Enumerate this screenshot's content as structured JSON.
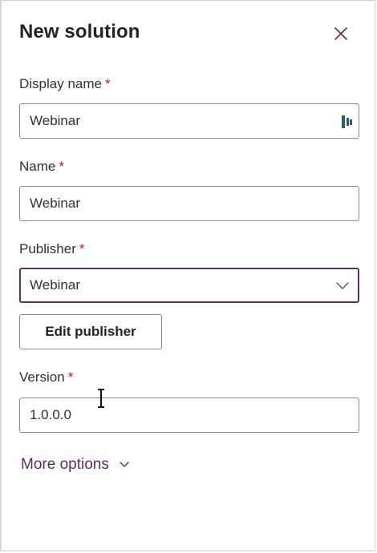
{
  "panel": {
    "title": "New solution",
    "close_icon": "close-icon"
  },
  "fields": {
    "display_name": {
      "label": "Display name",
      "required": "*",
      "value": "Webinar"
    },
    "name": {
      "label": "Name",
      "required": "*",
      "value": "Webinar"
    },
    "publisher": {
      "label": "Publisher",
      "required": "*",
      "value": "Webinar"
    },
    "version": {
      "label": "Version",
      "required": "*",
      "value": "1.0.0.0"
    }
  },
  "buttons": {
    "edit_publisher": "Edit publisher"
  },
  "links": {
    "more_options": "More options"
  },
  "colors": {
    "accent": "#5c2e5c",
    "required": "#a4262c",
    "border": "#8a8886"
  }
}
